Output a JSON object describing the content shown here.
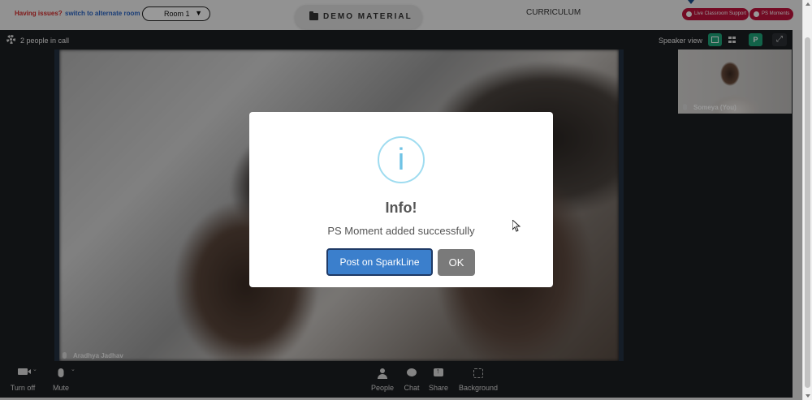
{
  "topbar": {
    "issues_text": "Having issues?",
    "alt_room_link": "switch to alternate room",
    "room_select": "Room 1",
    "demo_material": "DEMO MATERIAL",
    "curriculum": "CURRICULUM",
    "live_support": "Live Classroom Support",
    "ps_moments": "PS Moments",
    "pill_color": "#c0133d"
  },
  "call": {
    "people_count": "2 people in call",
    "speaker_view_label": "Speaker view",
    "avatar_initial": "P",
    "main_participant": "Aradhya Jadhav",
    "self_participant": "Someya (You)"
  },
  "toolbar": {
    "turn_off": "Turn off",
    "mute": "Mute",
    "people": "People",
    "chat": "Chat",
    "share": "Share",
    "background": "Background"
  },
  "modal": {
    "icon": "info-icon",
    "title": "Info!",
    "message": "PS Moment added successfully",
    "post_button": "Post on SparkLine",
    "ok_button": "OK",
    "accent": "#3b7fcc"
  }
}
